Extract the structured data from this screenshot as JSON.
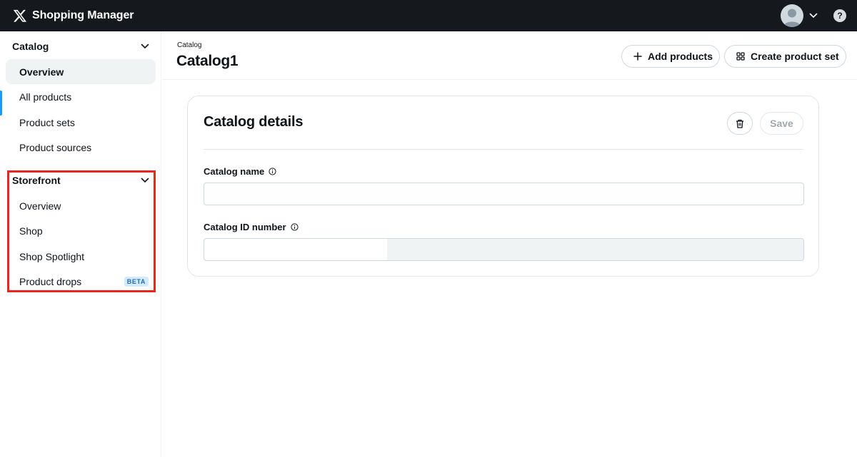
{
  "app": {
    "brand_name": "Shopping Manager",
    "logo_icon": "x-logo-icon",
    "help_label": "?"
  },
  "sidebar": {
    "catalog": {
      "title": "Catalog",
      "items": [
        {
          "label": "Overview",
          "active": true
        },
        {
          "label": "All products"
        },
        {
          "label": "Product sets"
        },
        {
          "label": "Product sources"
        }
      ]
    },
    "storefront": {
      "title": "Storefront",
      "items": [
        {
          "label": "Overview"
        },
        {
          "label": "Shop"
        },
        {
          "label": "Shop Spotlight"
        },
        {
          "label": "Product drops",
          "badge": "BETA"
        }
      ]
    }
  },
  "header": {
    "breadcrumb": "Catalog",
    "title": "Catalog1",
    "add_products_label": "Add products",
    "create_set_label": "Create product set"
  },
  "card": {
    "title": "Catalog details",
    "save_label": "Save",
    "catalog_name_label": "Catalog name",
    "catalog_name_value": "",
    "catalog_id_label": "Catalog ID number"
  },
  "colors": {
    "topbar": "#15181c",
    "accent": "#1d9bf0",
    "highlight_box": "#e8271d",
    "beta_badge_bg": "#d6eafd"
  }
}
